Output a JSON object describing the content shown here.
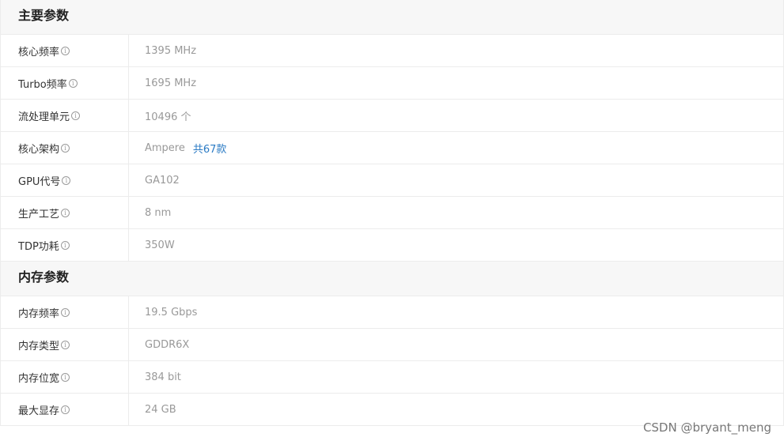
{
  "sections": [
    {
      "title": "主要参数",
      "rows": [
        {
          "label": "核心频率",
          "value": "1395 MHz"
        },
        {
          "label": "Turbo频率",
          "value": "1695 MHz"
        },
        {
          "label": "流处理单元",
          "value": "10496 个"
        },
        {
          "label": "核心架构",
          "value": "Ampere",
          "link": "共67款"
        },
        {
          "label": "GPU代号",
          "value": "GA102"
        },
        {
          "label": "生产工艺",
          "value": "8 nm"
        },
        {
          "label": "TDP功耗",
          "value": "350W"
        }
      ]
    },
    {
      "title": "内存参数",
      "rows": [
        {
          "label": "内存频率",
          "value": "19.5 Gbps"
        },
        {
          "label": "内存类型",
          "value": "GDDR6X"
        },
        {
          "label": "内存位宽",
          "value": "384 bit"
        },
        {
          "label": "最大显存",
          "value": "24 GB"
        }
      ]
    }
  ],
  "info_icon": {
    "name": "info-icon",
    "glyph": "i"
  },
  "watermark": "CSDN @bryant_meng",
  "colors": {
    "link": "#2a7ac4",
    "label": "#333333",
    "value": "#999999",
    "header_bg": "#f7f7f7"
  }
}
